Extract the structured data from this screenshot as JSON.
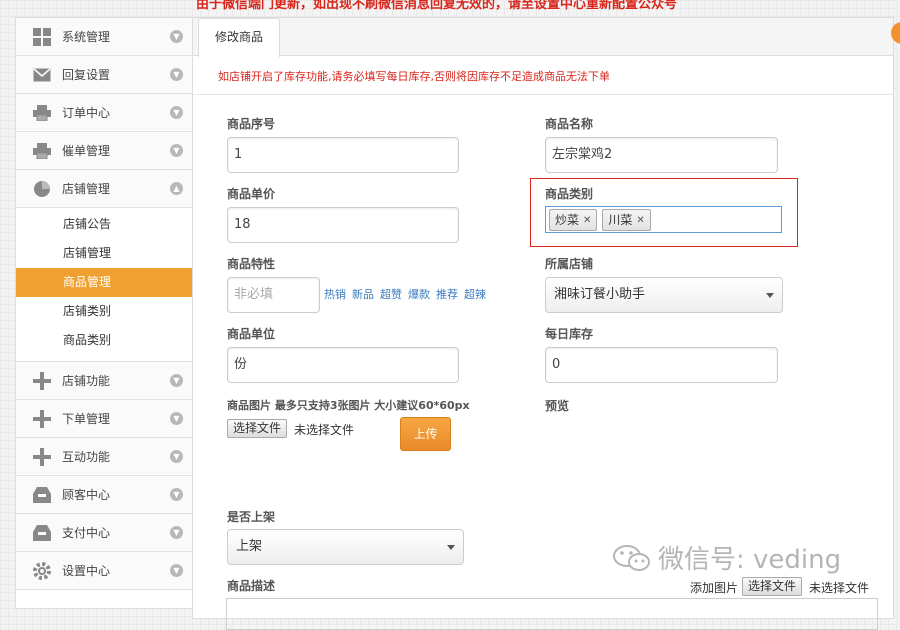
{
  "notice": "由于微信端门更新，如出现不刷微信消息回复无效的，请至设置中心重新配置公众号",
  "sidebar": {
    "items": [
      {
        "label": "系统管理",
        "icon": "grid-icon"
      },
      {
        "label": "回复设置",
        "icon": "mail-icon"
      },
      {
        "label": "订单中心",
        "icon": "printer-icon"
      },
      {
        "label": "催单管理",
        "icon": "printer-icon"
      },
      {
        "label": "店铺管理",
        "icon": "pie-chart-icon"
      }
    ],
    "sub_items": [
      "店铺公告",
      "店铺管理",
      "商品管理",
      "店铺类别",
      "商品类别"
    ],
    "active_sub": "商品管理",
    "items_after": [
      {
        "label": "店铺功能",
        "icon": "plus-icon"
      },
      {
        "label": "下单管理",
        "icon": "plus-icon"
      },
      {
        "label": "互动功能",
        "icon": "plus-icon"
      },
      {
        "label": "顾客中心",
        "icon": "inbox-icon"
      },
      {
        "label": "支付中心",
        "icon": "inbox-icon"
      },
      {
        "label": "设置中心",
        "icon": "gear-icon"
      }
    ]
  },
  "tab": "修改商品",
  "warning": "如店铺开启了库存功能,请务必填写每日库存,否则将因库存不足造成商品无法下单",
  "form": {
    "seq_label": "商品序号",
    "seq_value": "1",
    "name_label": "商品名称",
    "name_value": "左宗棠鸡2",
    "price_label": "商品单价",
    "price_value": "18",
    "category_label": "商品类别",
    "categories": [
      "炒菜",
      "川菜"
    ],
    "feature_label": "商品特性",
    "feature_placeholder": "非必填",
    "feature_tags": [
      "热销",
      "新品",
      "超赞",
      "爆款",
      "推荐",
      "超辣"
    ],
    "shop_label": "所属店铺",
    "shop_value": "湘味订餐小助手",
    "unit_label": "商品单位",
    "unit_value": "份",
    "stock_label": "每日库存",
    "stock_value": "0",
    "image_label": "商品图片 最多只支持3张图片 大小建议60*60px",
    "preview_label": "预览",
    "choose_file": "选择文件",
    "no_file": "未选择文件",
    "upload": "上传",
    "onsale_label": "是否上架",
    "onsale_value": "上架",
    "desc_label": "商品描述",
    "add_image": "添加图片"
  },
  "watermark": "微信号: veding"
}
